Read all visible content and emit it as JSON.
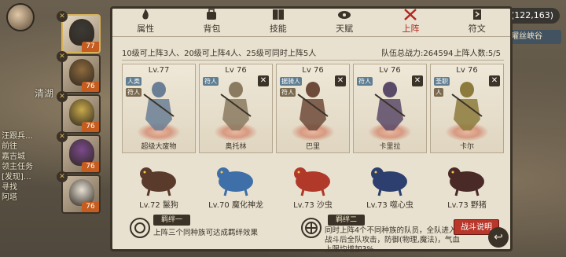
{
  "map": {
    "coord": "(122,163)",
    "map_label": "曜丝峡谷",
    "area_text": "清湖",
    "side_messages": [
      "汪跟兵…",
      "前往",
      "嘉吉城",
      "领主任务",
      "[发现]…",
      "寻找",
      "阿塔"
    ]
  },
  "roster": [
    {
      "lv": "77",
      "selected": true
    },
    {
      "lv": "76",
      "selected": false
    },
    {
      "lv": "76",
      "selected": false
    },
    {
      "lv": "76",
      "selected": false
    },
    {
      "lv": "76",
      "selected": false
    }
  ],
  "tabs": [
    {
      "label": "属性",
      "icon": "flame-icon",
      "active": false
    },
    {
      "label": "背包",
      "icon": "bag-icon",
      "active": false
    },
    {
      "label": "技能",
      "icon": "book-icon",
      "active": false
    },
    {
      "label": "天赋",
      "icon": "eye-icon",
      "active": false
    },
    {
      "label": "上阵",
      "icon": "swords-icon",
      "active": true
    },
    {
      "label": "符文",
      "icon": "rune-icon",
      "active": false
    }
  ],
  "info": {
    "rule": "10级可上阵3人、20级可上阵4人、25级可同时上阵5人",
    "power_label": "队伍总战力:264594",
    "count_label": "上阵人数:5/5"
  },
  "cards": [
    {
      "lv": "Lv.77",
      "name": "超级大废物",
      "tags": [
        "人类",
        "符人"
      ],
      "removable": false,
      "color": "#6a7f95"
    },
    {
      "lv": "Lv 76",
      "name": "奥托林",
      "tags": [
        "符人"
      ],
      "removable": true,
      "color": "#8a7a60"
    },
    {
      "lv": "Lv 76",
      "name": "巴里",
      "tags": [
        "据骑人",
        "符人"
      ],
      "removable": true,
      "color": "#6e4a3a"
    },
    {
      "lv": "Lv 76",
      "name": "卡里拉",
      "tags": [
        "符人"
      ],
      "removable": true,
      "color": "#5a4a68"
    },
    {
      "lv": "Lv 76",
      "name": "卡尔",
      "tags": [
        "圣职",
        "人"
      ],
      "removable": true,
      "color": "#8c7b3c"
    }
  ],
  "pets": [
    {
      "label": "Lv.72 鬣狗",
      "color": "#5a3a2a"
    },
    {
      "label": "Lv.70 魔化神龙",
      "color": "#3f6fa8"
    },
    {
      "label": "Lv.73 沙虫",
      "color": "#b0392a"
    },
    {
      "label": "Lv.73 噬心虫",
      "color": "#2d3f6e"
    },
    {
      "label": "Lv.73 野猪",
      "color": "#4a2a26"
    }
  ],
  "bonds": {
    "bond1_title": "羁绊一",
    "bond1_text": "上阵三个同种族可达成羁绊效果",
    "bond2_title": "羁绊二",
    "bond2_text_1": "同时上阵4个不同种族的队员，全队进入",
    "bond2_text_2": "战斗后全队攻击，防御(物理,魔法)，气血",
    "bond2_text_3": "上限均增加3%",
    "battle_btn": "战斗说明"
  },
  "colors": {
    "panel": "#e9e1d0",
    "accent": "#b3261e",
    "dark": "#3b3328"
  }
}
